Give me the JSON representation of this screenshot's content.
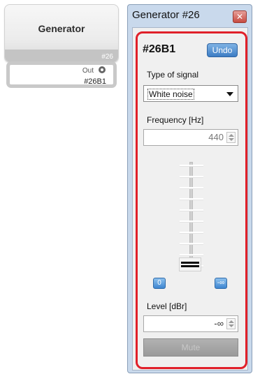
{
  "generator_block": {
    "title": "Generator",
    "id": "#26",
    "port_label": "Out",
    "port_name": "#26B1"
  },
  "window": {
    "title": "Generator #26",
    "close_icon": "close-icon",
    "code": "#26B1",
    "undo_label": "Undo",
    "signal_type_label": "Type of signal",
    "signal_type_value": "White noise",
    "frequency_label": "Frequency [Hz]",
    "frequency_value": "440",
    "level_label": "Level [dBr]",
    "level_value": "-∞",
    "zero_button": "0",
    "min_button": "-∞",
    "mute_label": "Mute",
    "slider_level": 0.0
  },
  "colors": {
    "panel_border": "#e0202a",
    "accent_button": "#3c7cc4",
    "window_frame": "#c9d9ec"
  }
}
